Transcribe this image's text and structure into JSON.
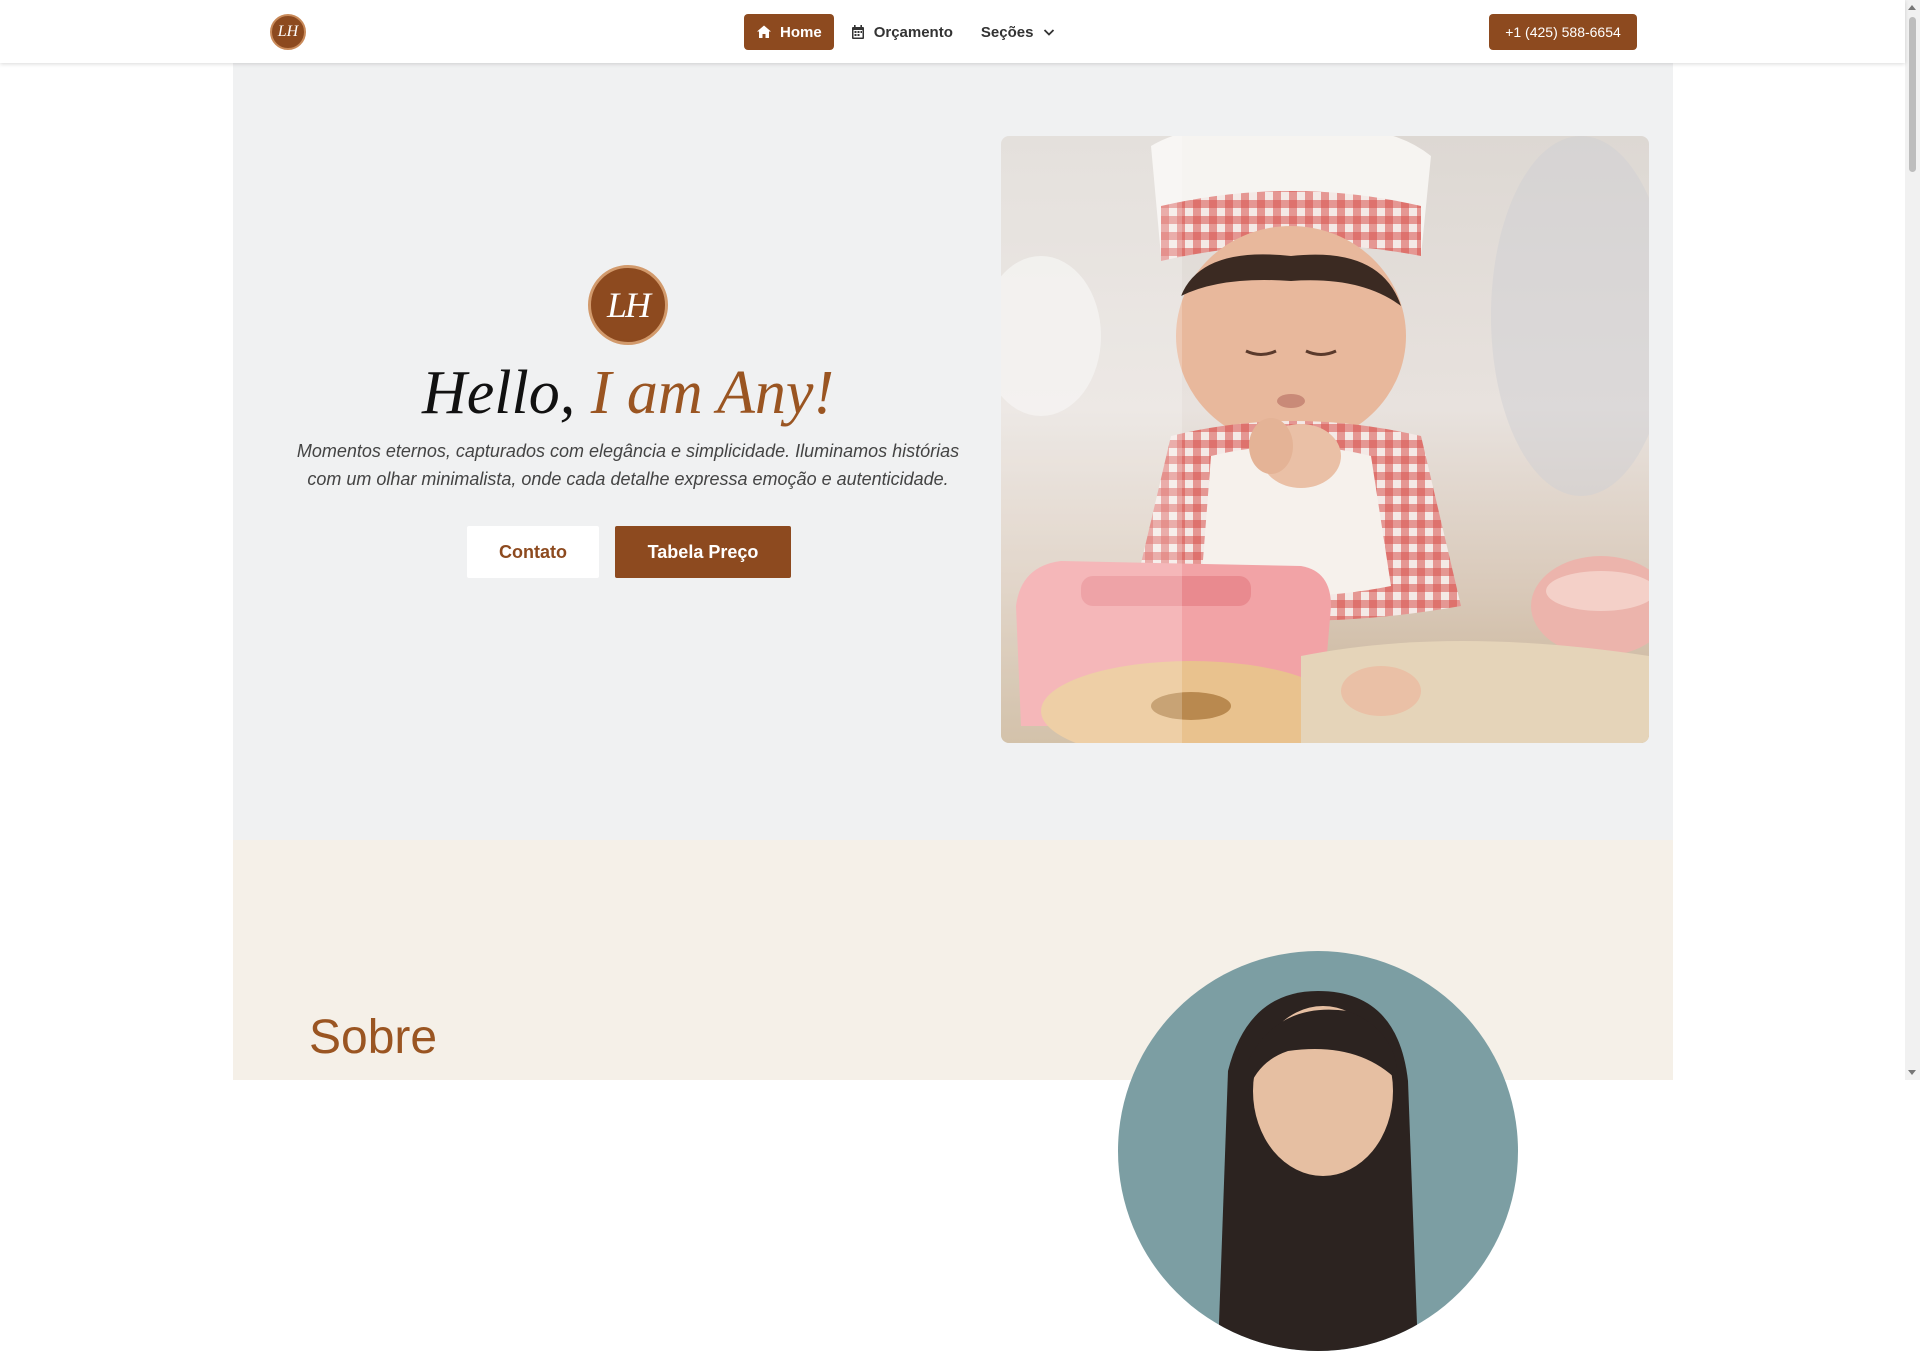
{
  "navbar": {
    "logo_text": "LH",
    "links": [
      {
        "label": "Home",
        "icon": "home-icon",
        "active": true
      },
      {
        "label": "Orçamento",
        "icon": "calendar-icon",
        "active": false
      },
      {
        "label": "Seções",
        "icon": "chevron-down-icon",
        "active": false
      }
    ],
    "phone": "+1 (425) 588-6654"
  },
  "hero": {
    "logo_text": "LH",
    "title_prefix": "Hello,",
    "title_accent": "I am Any!",
    "subtitle": "Momentos eternos, capturados com elegância e simplicidade. Iluminamos histórias com um olhar minimalista, onde cada detalhe expressa emoção e autenticidade.",
    "btn_contact": "Contato",
    "btn_pricing": "Tabela Preço"
  },
  "about": {
    "title": "Sobre"
  },
  "colors": {
    "brand": "#8d4a1f",
    "accent_text": "#9a5522",
    "hero_bg": "#f0f1f2",
    "about_bg": "#f5f0e8"
  }
}
